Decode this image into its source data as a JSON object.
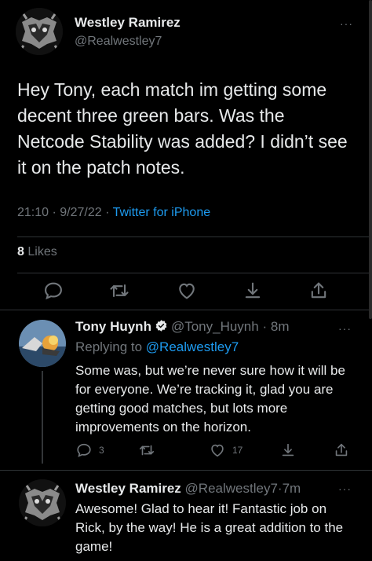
{
  "main_tweet": {
    "author_name": "Westley Ramirez",
    "author_handle": "@Realwestley7",
    "text": "Hey Tony, each match im getting some decent three green bars. Was the Netcode Stability was added? I didn’t see it on the patch notes.",
    "time": "21:10",
    "date": "9/27/22",
    "source": "Twitter for iPhone",
    "likes_count": "8",
    "likes_label": "Likes",
    "more_glyph": "···"
  },
  "reply": {
    "author_name": "Tony Huynh",
    "author_handle": "@Tony_Huynh",
    "age": "8m",
    "replying_prefix": "Replying to",
    "replying_to": "@Realwestley7",
    "text": "Some was, but we’re never sure how it will be for everyone. We’re tracking it, glad you are getting good matches, but lots more improvements on the horizon.",
    "replies_count": "3",
    "likes_count": "17",
    "more_glyph": "···"
  },
  "third_tweet": {
    "author_name": "Westley Ramirez",
    "author_handle": "@Realwestley7",
    "age": "7m",
    "text": "Awesome! Glad to hear it! Fantastic job on Rick, by the way! He is a great addition to the game!",
    "more_glyph": "···"
  },
  "separator_dot": "·",
  "colors": {
    "background": "#000000",
    "text": "#e7e9ea",
    "muted": "#71767b",
    "link_blue": "#1d9bf0",
    "divider": "#2f3336"
  },
  "icons": {
    "reply": "comment-icon",
    "retweet": "retweet-icon",
    "like": "heart-icon",
    "bookmark": "bookmark-down-icon",
    "share": "share-icon",
    "verified": "verified-badge-icon"
  }
}
